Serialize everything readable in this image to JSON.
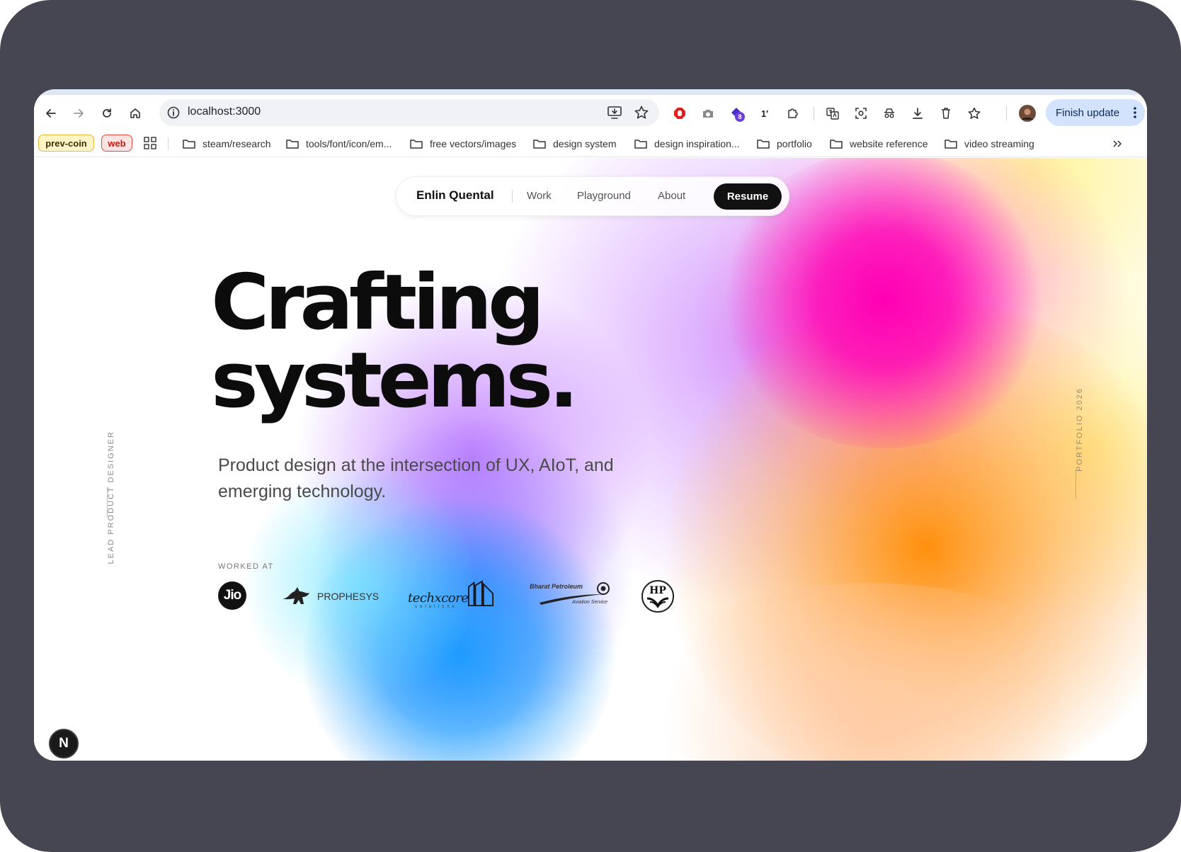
{
  "browser": {
    "url": "localhost:3000",
    "extension_badge": "8",
    "extension_text": "1′",
    "finish_update_label": "Finish update"
  },
  "bookmarks": {
    "chips": [
      "prev-coin",
      "web"
    ],
    "folders": [
      "steam/research",
      "tools/font/icon/em...",
      "free vectors/images",
      "design system",
      "design inspiration...",
      "portfolio",
      "website reference",
      "video streaming"
    ]
  },
  "nav": {
    "brand": "Enlin Quental",
    "links": [
      "Work",
      "Playground",
      "About"
    ],
    "cta": "Resume"
  },
  "hero": {
    "headline_line1": "Crafting",
    "headline_line2": "systems.",
    "subline": "Product design at the intersection of UX, AIoT, and emerging technology.",
    "side_left": "LEAD PRODUCT DESIGNER",
    "side_right": "PORTFOLIO 2026"
  },
  "worked_at": {
    "label": "WORKED AT",
    "logos": [
      {
        "name": "jio-logo",
        "text": "Jio"
      },
      {
        "name": "prophesys-logo",
        "text": "PROPHESYS"
      },
      {
        "name": "techxcore-logo",
        "text": "techxcore",
        "subtext": "solutions"
      },
      {
        "name": "bharat-petroleum-logo",
        "text": "Bharat Petroleum",
        "subtext": "Aviation Service"
      },
      {
        "name": "hp-logo",
        "text": "HP"
      }
    ]
  },
  "dev_badge": "N",
  "colors": {
    "frame": "#464652",
    "finish_update_bg": "#d3e3fd",
    "nav_cta_bg": "#111111",
    "gradient_magenta": "#ff00b4",
    "gradient_orange": "#ff8a00",
    "gradient_blue": "#1e9bff",
    "gradient_purple": "#c77dff",
    "gradient_yellow": "#fff39a"
  }
}
